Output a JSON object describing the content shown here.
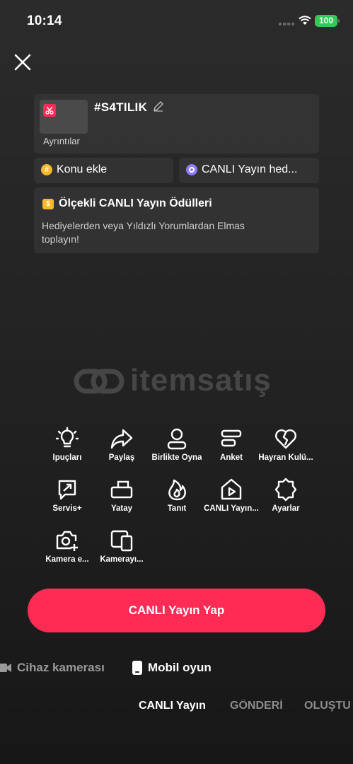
{
  "status_bar": {
    "time": "10:14",
    "battery": "100"
  },
  "stream_card": {
    "title": "#S4TILIK",
    "details_label": "Ayrıntılar"
  },
  "topic_pill": {
    "label": "Konu ekle"
  },
  "goal_pill": {
    "label": "CANLI Yayın hed..."
  },
  "rewards": {
    "title": "Ölçekli CANLI Yayın Ödülleri",
    "description": "Hediyelerden veya Yıldızlı Yorumlardan Elmas toplayın!"
  },
  "watermark": {
    "brand": "itemsatış"
  },
  "tools": [
    {
      "label": "İpuçları",
      "icon": "lightbulb-icon"
    },
    {
      "label": "Paylaş",
      "icon": "share-icon"
    },
    {
      "label": "Birlikte Oyna",
      "icon": "person-icon"
    },
    {
      "label": "Anket",
      "icon": "poll-icon"
    },
    {
      "label": "Hayran Kulü...",
      "icon": "heart-icon"
    },
    {
      "label": "Servis+",
      "icon": "service-icon"
    },
    {
      "label": "Yatay",
      "icon": "landscape-icon"
    },
    {
      "label": "Tanıt",
      "icon": "flame-icon"
    },
    {
      "label": "CANLI Yayın...",
      "icon": "live-home-icon"
    },
    {
      "label": "Ayarlar",
      "icon": "settings-icon"
    },
    {
      "label": "Kamera e...",
      "icon": "camera-add-icon"
    },
    {
      "label": "Kamerayı...",
      "icon": "devices-icon"
    }
  ],
  "go_live_button": {
    "label": "CANLI Yayın Yap",
    "color": "#fe2c55"
  },
  "sources": {
    "device_camera": "Cihaz kamerası",
    "mobile_game": "Mobil oyun"
  },
  "modes": {
    "live": "CANLI Yayın",
    "post": "GÖNDERİ",
    "create": "OLUŞTU"
  }
}
